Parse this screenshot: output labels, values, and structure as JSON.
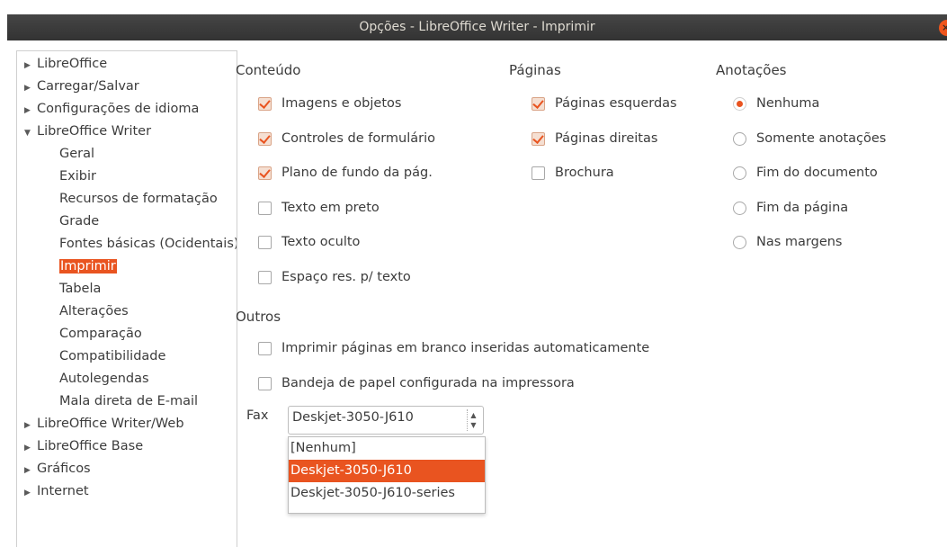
{
  "window": {
    "title": "Opções - LibreOffice Writer - Imprimir",
    "close_glyph": "×"
  },
  "tree": {
    "items": [
      {
        "label": "LibreOffice",
        "level": 0,
        "expander": "▶"
      },
      {
        "label": "Carregar/Salvar",
        "level": 0,
        "expander": "▶"
      },
      {
        "label": "Configurações de idioma",
        "level": 0,
        "expander": "▶"
      },
      {
        "label": "LibreOffice Writer",
        "level": 0,
        "expander": "▼"
      },
      {
        "label": "Geral",
        "level": 1
      },
      {
        "label": "Exibir",
        "level": 1
      },
      {
        "label": "Recursos de formatação",
        "level": 1
      },
      {
        "label": "Grade",
        "level": 1
      },
      {
        "label": "Fontes básicas (Ocidentais)",
        "level": 1
      },
      {
        "label": "Imprimir",
        "level": 1,
        "selected": true
      },
      {
        "label": "Tabela",
        "level": 1
      },
      {
        "label": "Alterações",
        "level": 1
      },
      {
        "label": "Comparação",
        "level": 1
      },
      {
        "label": "Compatibilidade",
        "level": 1
      },
      {
        "label": "Autolegendas",
        "level": 1
      },
      {
        "label": "Mala direta de E-mail",
        "level": 1
      },
      {
        "label": "LibreOffice Writer/Web",
        "level": 0,
        "expander": "▶"
      },
      {
        "label": "LibreOffice Base",
        "level": 0,
        "expander": "▶"
      },
      {
        "label": "Gráficos",
        "level": 0,
        "expander": "▶"
      },
      {
        "label": "Internet",
        "level": 0,
        "expander": "▶"
      }
    ]
  },
  "conteudo": {
    "title": "Conteúdo",
    "options": [
      {
        "label": "Imagens e objetos",
        "checked": true
      },
      {
        "label": "Controles de formulário",
        "checked": true
      },
      {
        "label": "Plano de fundo da pág.",
        "checked": true
      },
      {
        "label": "Texto em preto",
        "checked": false
      },
      {
        "label": "Texto oculto",
        "checked": false
      },
      {
        "label": "Espaço res. p/ texto",
        "checked": false
      }
    ]
  },
  "paginas": {
    "title": "Páginas",
    "options": [
      {
        "label": "Páginas esquerdas",
        "checked": true
      },
      {
        "label": "Páginas direitas",
        "checked": true
      },
      {
        "label": "Brochura",
        "checked": false
      }
    ]
  },
  "anotacoes": {
    "title": "Anotações",
    "options": [
      {
        "label": "Nenhuma",
        "checked": true
      },
      {
        "label": "Somente anotações",
        "checked": false
      },
      {
        "label": "Fim do documento",
        "checked": false
      },
      {
        "label": "Fim da página",
        "checked": false
      },
      {
        "label": "Nas margens",
        "checked": false
      }
    ]
  },
  "outros": {
    "title": "Outros",
    "options": [
      {
        "label": "Imprimir páginas em branco inseridas automaticamente",
        "checked": false
      },
      {
        "label": "Bandeja de papel configurada na impressora",
        "checked": false
      }
    ],
    "fax_label": "Fax",
    "fax_value": "Deskjet-3050-J610",
    "fax_options": [
      {
        "label": "[Nenhum]",
        "selected": false
      },
      {
        "label": "Deskjet-3050-J610",
        "selected": true
      },
      {
        "label": "Deskjet-3050-J610-series",
        "selected": false
      }
    ]
  },
  "colors": {
    "accent": "#e95420",
    "titlebar": "#3c3c3c"
  }
}
